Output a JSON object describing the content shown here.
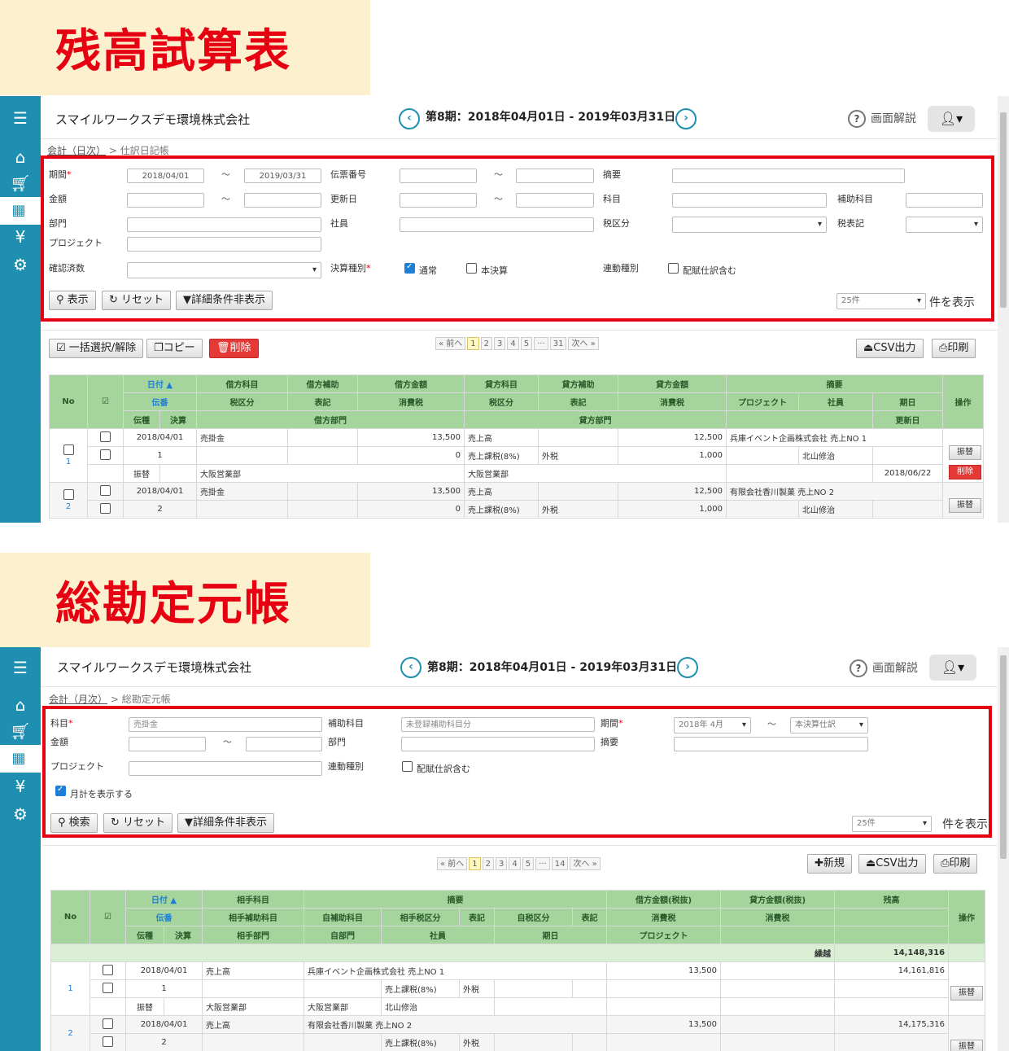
{
  "banner1": {
    "title": "残高試算表"
  },
  "banner2": {
    "title": "総勘定元帳"
  },
  "common": {
    "company": "スマイルワークスデモ環境株式会社",
    "period": "第8期：2018年04月01日 - 2019年03月31日",
    "help": "画面解説",
    "prev": "‹",
    "next": "›",
    "tilde": "～",
    "unit_label": "件を表示",
    "unit_option": "25件"
  },
  "shot1": {
    "breadcrumb_root": "会計（日次）",
    "breadcrumb_current": " > 仕訳日記帳",
    "labels": {
      "period": "期間",
      "slip_no": "伝票番号",
      "summary": "摘要",
      "amount": "金額",
      "updated": "更新日",
      "account": "科目",
      "sub_account": "補助科目",
      "dept": "部門",
      "staff": "社員",
      "tax_class": "税区分",
      "tax_notation": "税表記",
      "project": "プロジェクト",
      "confirmed": "確認済数",
      "settle_type": "決算種別",
      "normal": "通常",
      "final": "本決算",
      "link_type": "連動種別",
      "include_alloc": "配賦仕訳含む"
    },
    "values": {
      "date_from": "2018/04/01",
      "date_to": "2019/03/31"
    },
    "buttons": {
      "show": "表示",
      "reset": "リセット",
      "detail": "詳細条件非表示",
      "bulk": "一括選択/解除",
      "copy": "コピー",
      "delete": "削除",
      "csv": "CSV出力",
      "print": "印刷"
    },
    "pager": [
      "« 前へ",
      "1",
      "2",
      "3",
      "4",
      "5",
      "···",
      "31",
      "次へ »"
    ],
    "headers": {
      "no": "No",
      "check": "☑",
      "date": "日付 ▲",
      "debit_acct": "借方科目",
      "debit_sub": "借方補助",
      "debit_amt": "借方金額",
      "credit_acct": "貸方科目",
      "credit_sub": "貸方補助",
      "credit_amt": "貸方金額",
      "summary": "摘要",
      "ops": "操作",
      "slip": "伝番",
      "tax_class": "税区分",
      "notation": "表記",
      "tax": "消費税",
      "project": "プロジェクト",
      "staff": "社員",
      "due": "期日",
      "slip_type": "伝種",
      "settle": "決算",
      "debit_dept": "借方部門",
      "credit_dept": "貸方部門",
      "updated": "更新日"
    },
    "rows": [
      {
        "no": "1",
        "date": "2018/04/01",
        "debit_acct": "売掛金",
        "debit_amt": "13,500",
        "credit_acct": "売上高",
        "credit_amt": "12,500",
        "summary": "兵庫イベント企画株式会社 売上NO 1",
        "slip": "1",
        "debit_tax": "0",
        "credit_tax_class": "売上課税(8%)",
        "notation": "外税",
        "credit_tax": "1,000",
        "staff": "北山修治",
        "slip_type": "振替",
        "debit_dept": "大阪営業部",
        "credit_dept": "大阪営業部",
        "updated": "2018/06/22",
        "btn": "振替",
        "del": "削除"
      },
      {
        "no": "2",
        "date": "2018/04/01",
        "debit_acct": "売掛金",
        "debit_amt": "13,500",
        "credit_acct": "売上高",
        "credit_amt": "12,500",
        "summary": "有限会社香川製菓 売上NO 2",
        "slip": "2",
        "debit_tax": "0",
        "credit_tax_class": "売上課税(8%)",
        "notation": "外税",
        "credit_tax": "1,000",
        "staff": "北山修治",
        "btn": "振替"
      }
    ]
  },
  "shot2": {
    "breadcrumb_root": "会計（月次）",
    "breadcrumb_current": " > 総勘定元帳",
    "labels": {
      "account": "科目",
      "sub_account": "補助科目",
      "period": "期間",
      "amount": "金額",
      "dept": "部門",
      "summary": "摘要",
      "project": "プロジェクト",
      "link_type": "連動種別",
      "include_alloc": "配賦仕訳含む",
      "monthly": "月計を表示する"
    },
    "values": {
      "account": "売掛金",
      "sub_account": "未登録補助科目分",
      "period_month": "2018年 4月",
      "period_end": "本決算仕訳"
    },
    "buttons": {
      "search": "検索",
      "reset": "リセット",
      "detail": "詳細条件非表示",
      "new": "新規",
      "csv": "CSV出力",
      "print": "印刷"
    },
    "pager": [
      "« 前へ",
      "1",
      "2",
      "3",
      "4",
      "5",
      "···",
      "14",
      "次へ »"
    ],
    "headers": {
      "no": "No",
      "check": "☑",
      "date": "日付 ▲",
      "counter_acct": "相手科目",
      "summary": "摘要",
      "debit_amt": "借方金額(税抜)",
      "credit_amt": "貸方金額(税抜)",
      "balance": "残高",
      "ops": "操作",
      "slip": "伝番",
      "counter_sub": "相手補助科目",
      "own_sub": "自補助科目",
      "counter_tax": "相手税区分",
      "notation": "表記",
      "own_tax": "自税区分",
      "tax": "消費税",
      "slip_type": "伝種",
      "settle": "決算",
      "counter_dept": "相手部門",
      "own_dept": "自部門",
      "staff": "社員",
      "due": "期日",
      "project": "プロジェクト"
    },
    "carry_label": "繰越",
    "carry_value": "14,148,316",
    "rows": [
      {
        "no": "1",
        "date": "2018/04/01",
        "counter_acct": "売上高",
        "summary": "兵庫イベント企画株式会社 売上NO 1",
        "debit_amt": "13,500",
        "balance": "14,161,816",
        "slip": "1",
        "counter_tax": "売上課税(8%)",
        "notation": "外税",
        "slip_type": "振替",
        "counter_dept": "大阪営業部",
        "own_dept": "大阪営業部",
        "staff": "北山修治",
        "btn": "振替"
      },
      {
        "no": "2",
        "date": "2018/04/01",
        "counter_acct": "売上高",
        "summary": "有限会社香川製菓 売上NO 2",
        "debit_amt": "13,500",
        "balance": "14,175,316",
        "slip": "2",
        "counter_tax": "売上課税(8%)",
        "notation": "外税",
        "btn": "振替"
      }
    ]
  }
}
